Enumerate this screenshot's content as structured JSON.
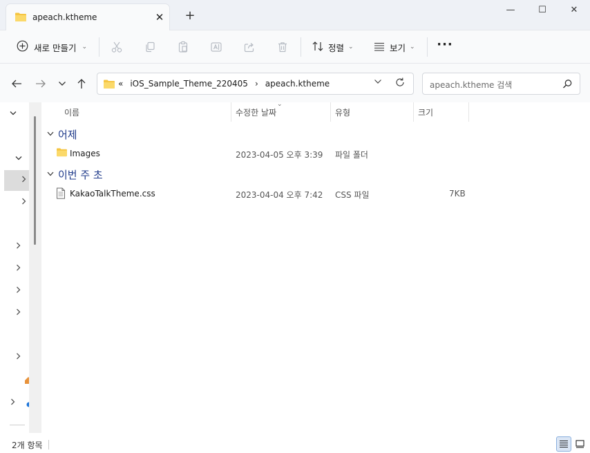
{
  "window": {
    "tab_title": "apeach.ktheme",
    "tab_close": "✕",
    "new_tab": "+",
    "minimize": "—",
    "maximize": "☐",
    "close": "✕"
  },
  "toolbar": {
    "new_label": "새로 만들기",
    "sort_label": "정렬",
    "view_label": "보기",
    "more_label": "···",
    "icons": [
      "cut-icon",
      "copy-icon",
      "paste-icon",
      "rename-icon",
      "share-icon",
      "delete-icon"
    ]
  },
  "address": {
    "overflow": "«",
    "crumbs": [
      "iOS_Sample_Theme_220405",
      "›",
      "apeach.ktheme"
    ]
  },
  "search": {
    "placeholder": "apeach.ktheme 검색"
  },
  "columns": {
    "name": "이름",
    "date": "수정한 날짜",
    "type": "유형",
    "size": "크기"
  },
  "groups": [
    {
      "label": "어제",
      "items": [
        {
          "name": "Images",
          "date": "2023-04-05 오후 3:39",
          "type": "파일 폴더",
          "size": "",
          "kind": "folder"
        }
      ]
    },
    {
      "label": "이번 주 초",
      "items": [
        {
          "name": "KakaoTalkTheme.css",
          "date": "2023-04-04 오후 7:42",
          "type": "CSS 파일",
          "size": "7KB",
          "kind": "file"
        }
      ]
    }
  ],
  "status": {
    "count": "2개 항목"
  },
  "colors": {
    "accent": "#1f3a8a",
    "folder": "#f5c542",
    "selection": "#dbe6f5"
  }
}
